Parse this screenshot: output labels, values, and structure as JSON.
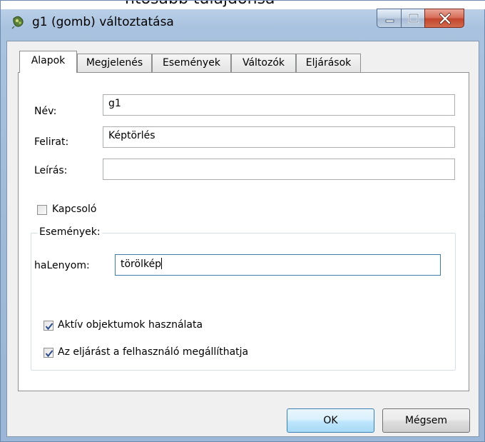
{
  "window": {
    "title": "g1 (gomb) változtatása",
    "colors": {
      "titlebar": "#a9c2df",
      "close_button": "#c2462d",
      "client": "#f0f0f0"
    }
  },
  "header_fragment": "ntosabb tulajdonsá",
  "tabs": [
    {
      "label": "Alapok",
      "active": true
    },
    {
      "label": "Megjelenés",
      "active": false
    },
    {
      "label": "Események",
      "active": false
    },
    {
      "label": "Változók",
      "active": false
    },
    {
      "label": "Eljárások",
      "active": false
    }
  ],
  "fields": {
    "name": {
      "label": "Név:",
      "value": "g1"
    },
    "caption": {
      "label": "Felirat:",
      "value": "Képtörlés"
    },
    "description": {
      "label": "Leírás:",
      "value": ""
    }
  },
  "switch": {
    "label": "Kapcsoló",
    "checked": false
  },
  "events": {
    "group_label": "Események:",
    "onclick": {
      "label": "haLenyom:",
      "value": "törölkép"
    },
    "active_objects": {
      "label": "Aktív objektumok használata",
      "checked": true
    },
    "user_can_stop": {
      "label": "Az eljárást a felhasználó megállíthatja",
      "checked": true
    }
  },
  "buttons": {
    "ok": "OK",
    "cancel": "Mégsem"
  }
}
